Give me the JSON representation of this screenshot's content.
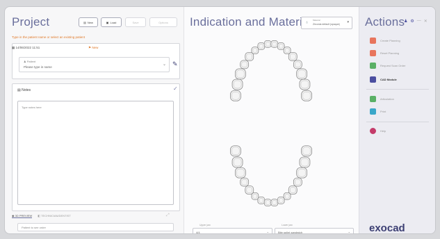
{
  "left": {
    "title": "Project",
    "toolbar": [
      {
        "label": "New",
        "disabled": false
      },
      {
        "label": "Load",
        "disabled": false
      },
      {
        "label": "Save",
        "disabled": true
      },
      {
        "label": "Options",
        "disabled": true
      }
    ],
    "warning": "Type in the patient name or select an existing patient",
    "date_row": "14/06/2022 11:51",
    "date_tag": "New",
    "patient_label": "Patient",
    "patient_placeholder": "Please type in name",
    "notes_label": "Notes",
    "notes_placeholder": "Type notes here",
    "tabs": [
      "3D PREVIEW",
      "TECHNICIAN/DENTIST"
    ],
    "bottom_field": "Patient to see order"
  },
  "middle": {
    "title": "Indication and Materials",
    "dropdown_label": "Material",
    "dropdown_value": "Zirconia default (opaque)",
    "upper_label": "Upper jaw",
    "upper_value": "4/4",
    "lower_label": "Lower jaw",
    "lower_value": "Bite splint sandwich"
  },
  "right": {
    "title": "Actions",
    "actions": [
      {
        "label": "Create Planning",
        "color": "#e8755d",
        "selected": false
      },
      {
        "label": "Reset Planning",
        "color": "#e8755d",
        "selected": false
      },
      {
        "label": "Request Scan Order",
        "color": "#5ab066",
        "selected": false
      },
      {
        "label": "CAD Module",
        "color": "#4b4ea0",
        "selected": true
      },
      {
        "label": "Articulation",
        "color": "#5ab066",
        "selected": false
      },
      {
        "label": "Print",
        "color": "#3aa7c9",
        "selected": false
      },
      {
        "label": "Help",
        "color": "#c43b6a",
        "selected": false
      }
    ],
    "logo": "exocad"
  }
}
